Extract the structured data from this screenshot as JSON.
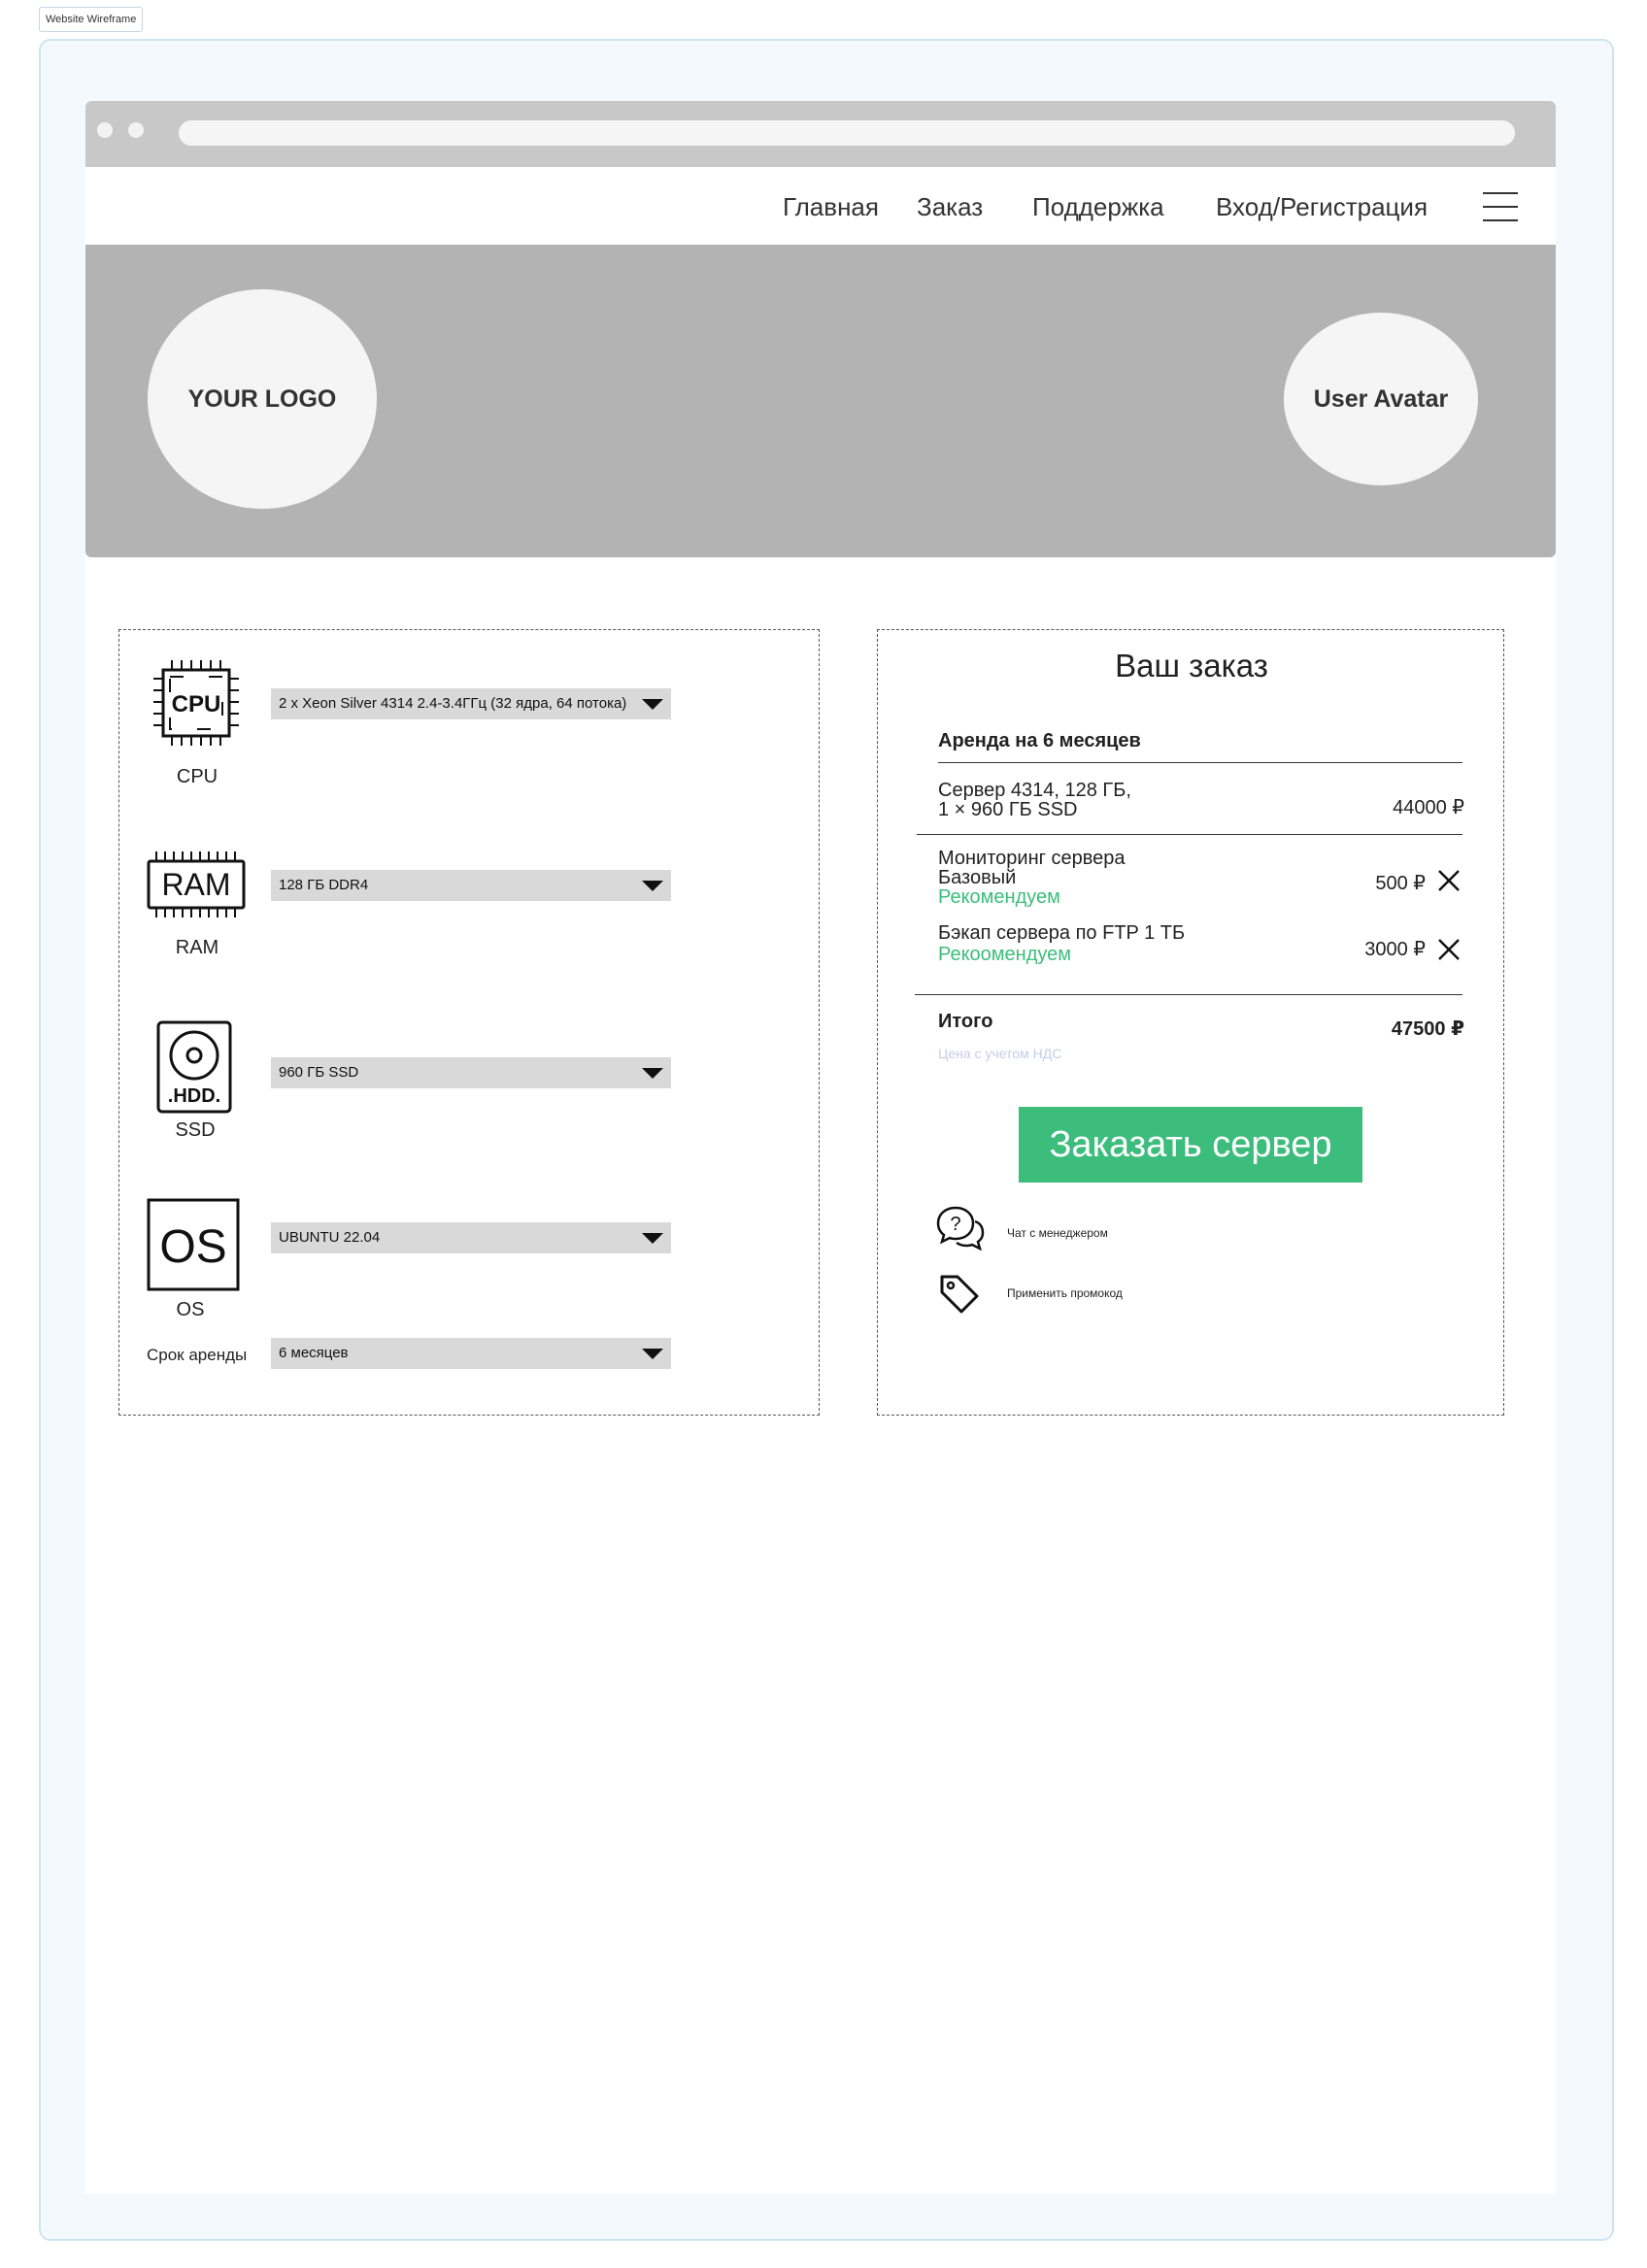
{
  "frame": {
    "label": "Website Wireframe"
  },
  "nav": {
    "items": [
      "Главная",
      "Заказ",
      "Поддержка",
      "Вход/Регистрация"
    ]
  },
  "hero": {
    "logo": "YOUR LOGO",
    "avatar": "User Avatar"
  },
  "config": {
    "cpu": {
      "icon_text": "CPU",
      "label": "CPU",
      "value": "2 x Xeon Silver 4314 2.4-3.4ГГц (32 ядра, 64 потока)"
    },
    "ram": {
      "icon_text": "RAM",
      "label": "RAM",
      "value": "128 ГБ DDR4"
    },
    "ssd": {
      "icon_text": ".HDD.",
      "label": "SSD",
      "value": "960 ГБ SSD"
    },
    "os": {
      "icon_text": "OS",
      "label": "OS",
      "value": "UBUNTU 22.04"
    },
    "term": {
      "label": "Срок аренды",
      "value": "6 месяцев"
    }
  },
  "order": {
    "title": "Ваш заказ",
    "rent_period": "Аренда на 6 месяцев",
    "server": {
      "line1": "Сервер 4314, 128 ГБ,",
      "line2": "1 × 960 ГБ SSD",
      "price": "44000 ₽"
    },
    "monitoring": {
      "line1": "Мониторинг сервера",
      "line2": "Базовый",
      "rec": "Рекомендуем",
      "price": "500 ₽"
    },
    "backup": {
      "line1": "Бэкап сервера по FTP 1 ТБ",
      "rec": "Рекоомендуем",
      "price": "3000 ₽"
    },
    "total": {
      "label": "Итого",
      "price": "47500 ₽",
      "note": "Цена с учетом НДС"
    },
    "order_button": "Заказать сервер",
    "chat_link": "Чат с менеджером",
    "promo_link": "Применить промокод"
  },
  "colors": {
    "accent": "#3cbd7b",
    "hero_bg": "#b3b3b3",
    "chrome_bg": "#c8c8c8",
    "select_bg": "#d9d9d9",
    "frame_border": "#cde3f2"
  }
}
